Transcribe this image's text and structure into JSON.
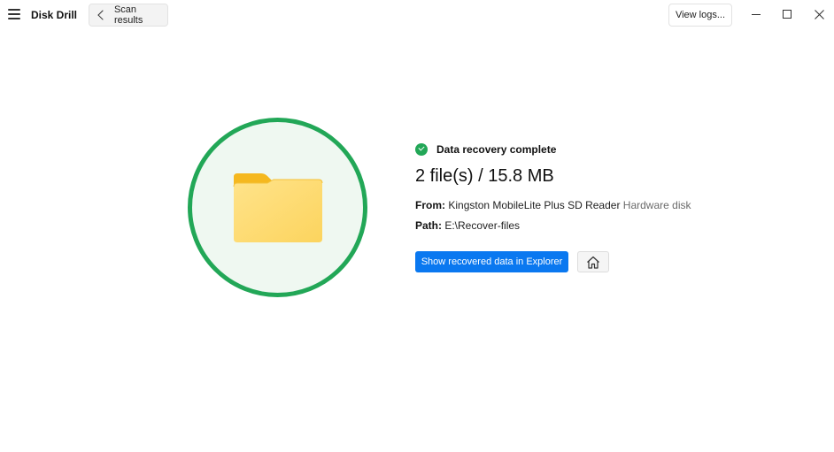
{
  "titlebar": {
    "app_title": "Disk Drill",
    "back_button_label": "Scan results",
    "view_logs_label": "View logs...",
    "icons": [
      "hamburger-menu-icon",
      "chevron-left-icon",
      "minimize-icon",
      "maximize-icon",
      "close-icon"
    ]
  },
  "recovery": {
    "status_text": "Data recovery complete",
    "summary": "2 file(s) / 15.8 MB",
    "from_label": "From:",
    "from_device": "Kingston MobileLite Plus SD Reader",
    "from_type": "Hardware disk",
    "path_label": "Path:",
    "path_value": "E:\\Recover-files",
    "show_button_label": "Show recovered data in Explorer",
    "icons": [
      "check-circle-icon",
      "folder-icon",
      "home-icon"
    ]
  },
  "colors": {
    "accent_green": "#22a757",
    "circle_fill": "#eff8f1",
    "primary_blue": "#0a78f0",
    "folder_yellow": "#fdd86a"
  }
}
